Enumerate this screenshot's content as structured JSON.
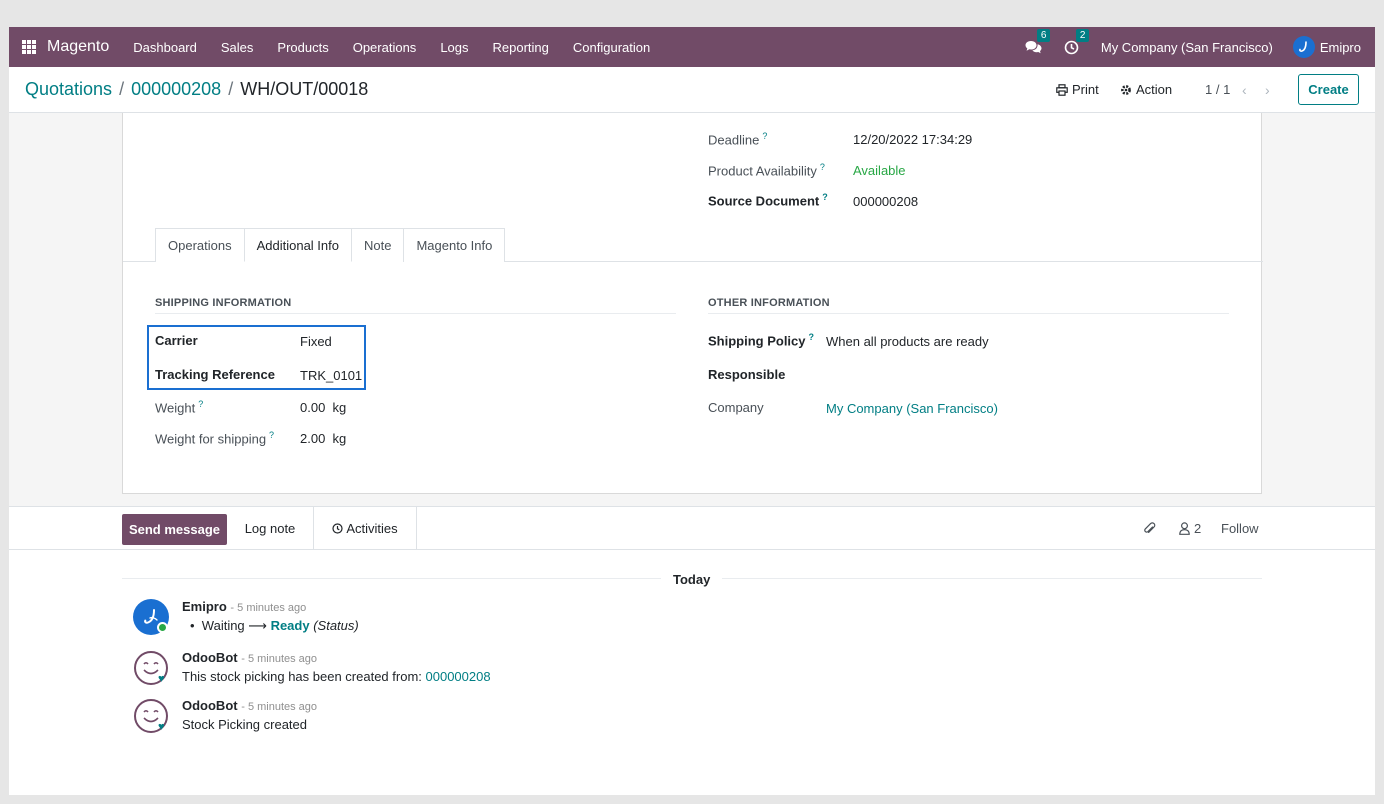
{
  "navbar": {
    "brand": "Magento",
    "menu": [
      "Dashboard",
      "Sales",
      "Products",
      "Operations",
      "Logs",
      "Reporting",
      "Configuration"
    ],
    "messages_badge": "6",
    "activities_badge": "2",
    "company": "My Company (San Francisco)",
    "user": "Emipro"
  },
  "breadcrumb": {
    "items": [
      "Quotations",
      "000000208"
    ],
    "separator": "/",
    "current": "WH/OUT/00018"
  },
  "control": {
    "print_label": "Print",
    "action_label": "Action",
    "pager": "1 / 1",
    "create_label": "Create"
  },
  "header_fields": {
    "deadline_label": "Deadline",
    "deadline_value": "12/20/2022 17:34:29",
    "availability_label": "Product Availability",
    "availability_value": "Available",
    "source_label": "Source Document",
    "source_value": "000000208",
    "help_mark": "?"
  },
  "tabs": [
    "Operations",
    "Additional Info",
    "Note",
    "Magento Info"
  ],
  "shipping": {
    "title": "SHIPPING INFORMATION",
    "carrier_label": "Carrier",
    "carrier_value": "Fixed",
    "tracking_label": "Tracking Reference",
    "tracking_value": "TRK_0101",
    "weight_label": "Weight",
    "weight_value": "0.00",
    "weight_unit": "kg",
    "weight_shipping_label": "Weight for shipping",
    "weight_shipping_value": "2.00",
    "weight_shipping_unit": "kg"
  },
  "other": {
    "title": "OTHER INFORMATION",
    "policy_label": "Shipping Policy",
    "policy_value": "When all products are ready",
    "responsible_label": "Responsible",
    "company_label": "Company",
    "company_value": "My Company (San Francisco)"
  },
  "chatter": {
    "send_label": "Send message",
    "log_label": "Log note",
    "activities_label": "Activities",
    "followers_count": "2",
    "follow_label": "Follow",
    "today_label": "Today",
    "messages": [
      {
        "author": "Emipro",
        "when": "- 5 minutes ago",
        "old_value": "Waiting",
        "arrow": "⟶",
        "new_value": "Ready",
        "field": "(Status)"
      },
      {
        "author": "OdooBot",
        "when": "- 5 minutes ago",
        "text": "This stock picking has been created from:",
        "link": "000000208"
      },
      {
        "author": "OdooBot",
        "when": "- 5 minutes ago",
        "text": "Stock Picking created"
      }
    ]
  },
  "colors": {
    "brand": "#714b67",
    "accent": "#017e84",
    "highlight": "#1a6fd1",
    "available": "#28a745"
  }
}
